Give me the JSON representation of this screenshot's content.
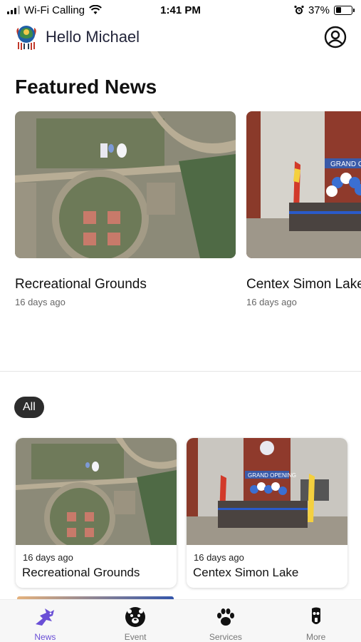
{
  "status_bar": {
    "carrier": "Wi-Fi Calling",
    "time": "1:41 PM",
    "battery": "37%",
    "battery_level": 0.37
  },
  "header": {
    "greeting": "Hello Michael",
    "logo_icon": "community-seal-logo",
    "profile_icon": "profile-icon"
  },
  "featured": {
    "title": "Featured News",
    "items": [
      {
        "title": "Recreational Grounds",
        "time": "16 days ago",
        "image": "aerial-field-photo"
      },
      {
        "title": "Centex Simon Lake",
        "time": "16 days ago",
        "image": "grand-opening-photo"
      }
    ]
  },
  "filter": {
    "chip_label": "All"
  },
  "grid": {
    "items": [
      {
        "title": "Recreational Grounds",
        "time": "16 days ago",
        "image": "aerial-field-photo"
      },
      {
        "title": "Centex Simon Lake",
        "time": "16 days ago",
        "image": "grand-opening-photo"
      }
    ]
  },
  "tabs": [
    {
      "label": "News",
      "icon": "news-bird-icon",
      "active": true
    },
    {
      "label": "Event",
      "icon": "bear-icon",
      "active": false
    },
    {
      "label": "Services",
      "icon": "paw-icon",
      "active": false
    },
    {
      "label": "More",
      "icon": "mask-icon",
      "active": false
    }
  ],
  "colors": {
    "accent": "#6a4fd6",
    "chip": "#2c2c2c"
  }
}
